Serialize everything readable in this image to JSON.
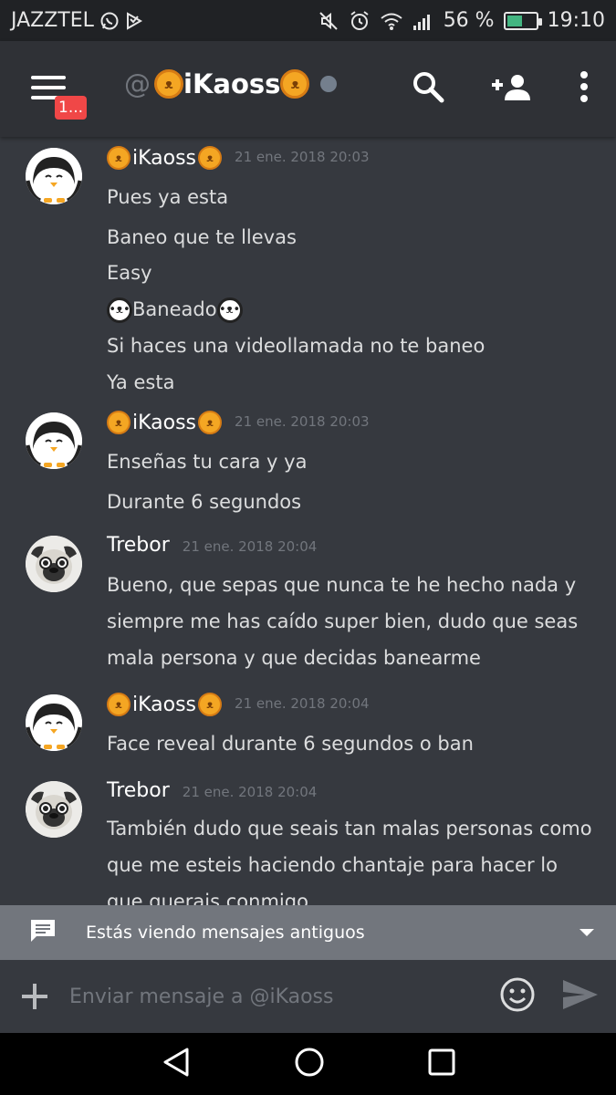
{
  "status_bar": {
    "carrier": "JAZZTEL",
    "battery_percent": "56 %",
    "time": "19:10",
    "battery_level": 0.56,
    "icons": [
      "whatsapp-icon",
      "notification-icon",
      "mute-icon",
      "alarm-icon",
      "wifi-icon",
      "signal-icon",
      "battery-icon"
    ]
  },
  "header": {
    "at_symbol": "@",
    "username": "iKaoss",
    "notification_badge": "1...",
    "status": "offline"
  },
  "messages": [
    {
      "author": "iKaoss",
      "timestamp": "21 ene. 2018 20:03",
      "avatar": "penguin",
      "lines": [
        {
          "text": "Pues ya esta"
        },
        {
          "text": "Baneo que te llevas"
        },
        {
          "text": "Easy"
        },
        {
          "text": "Baneado",
          "panda": true
        },
        {
          "text": "Si haces una videollamada no te baneo"
        },
        {
          "text": "Ya esta"
        }
      ]
    },
    {
      "author": "iKaoss",
      "timestamp": "21 ene. 2018 20:03",
      "avatar": "penguin",
      "lines": [
        {
          "text": "Enseñas tu cara y ya"
        },
        {
          "text": "Durante 6 segundos"
        }
      ]
    },
    {
      "author": "Trebor",
      "timestamp": "21 ene. 2018 20:04",
      "avatar": "pug",
      "lines": [
        {
          "text": "Bueno, que sepas que nunca te he hecho nada y siempre me has caído super bien, dudo que seas mala persona y que decidas banearme",
          "wrap": true
        }
      ]
    },
    {
      "author": "iKaoss",
      "timestamp": "21 ene. 2018 20:04",
      "avatar": "penguin",
      "lines": [
        {
          "text": "Face reveal durante 6 segundos o ban"
        }
      ]
    },
    {
      "author": "Trebor",
      "timestamp": "21 ene. 2018 20:04",
      "avatar": "pug",
      "lines": [
        {
          "text": "También dudo que seais tan malas personas como que me esteis haciendo chantaje para hacer lo que querais conmigo",
          "wrap": true
        }
      ]
    }
  ],
  "old_messages_bar": {
    "label": "Estás viendo mensajes antiguos"
  },
  "composer": {
    "placeholder": "Enviar mensaje a @iKaoss"
  },
  "colors": {
    "background": "#36393f",
    "header": "#2f3136",
    "status_bar": "#202225",
    "badge": "#f04747",
    "old_bar": "#72767d"
  }
}
